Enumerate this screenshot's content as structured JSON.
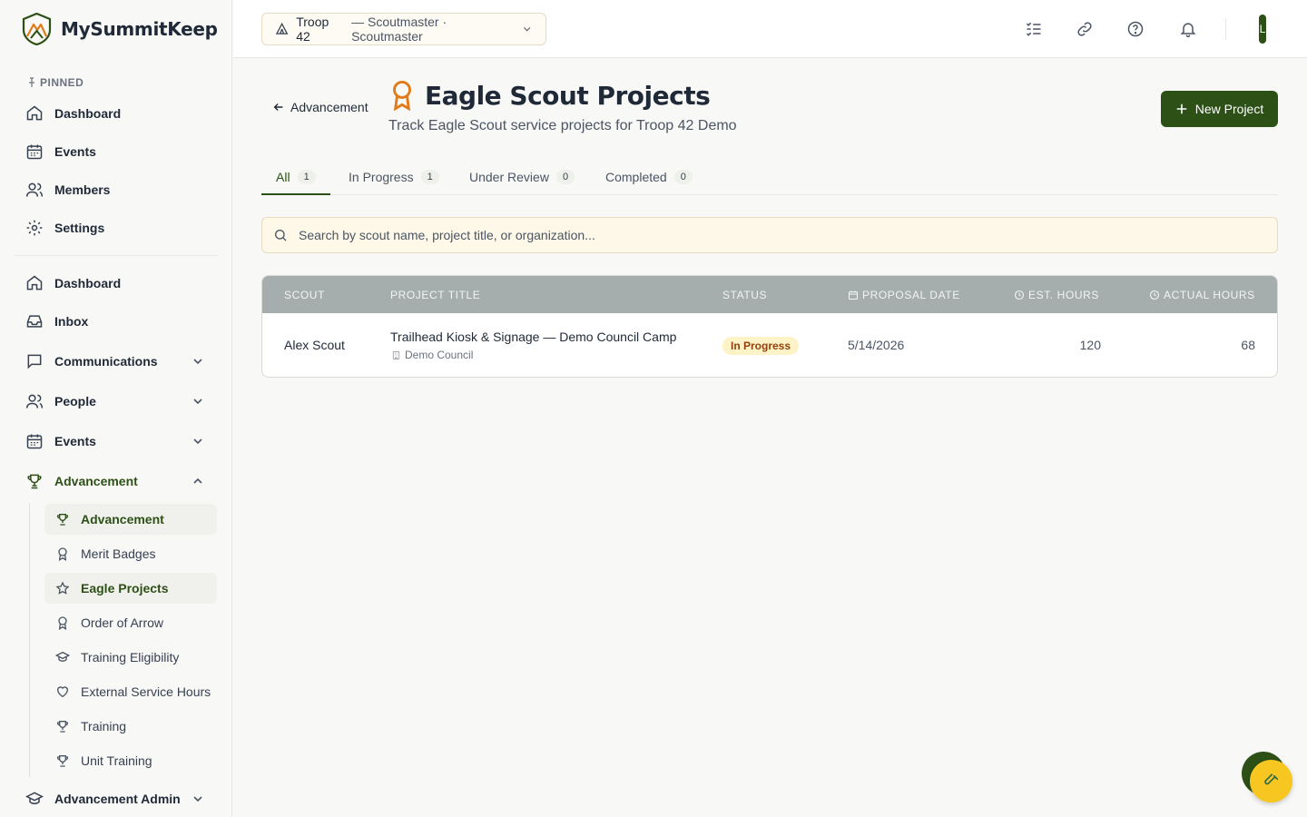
{
  "app": {
    "name": "MySummitKeep"
  },
  "sidebar": {
    "pinned_label": "PINNED",
    "pinned": [
      {
        "label": "Dashboard",
        "icon": "home-icon"
      },
      {
        "label": "Events",
        "icon": "calendar-icon"
      },
      {
        "label": "Members",
        "icon": "users-icon"
      },
      {
        "label": "Settings",
        "icon": "gear-icon"
      }
    ],
    "nav": [
      {
        "label": "Dashboard",
        "icon": "home-icon"
      },
      {
        "label": "Inbox",
        "icon": "inbox-icon"
      },
      {
        "label": "Communications",
        "icon": "message-icon",
        "expandable": true
      },
      {
        "label": "People",
        "icon": "users-icon",
        "expandable": true
      },
      {
        "label": "Events",
        "icon": "calendar-icon",
        "expandable": true
      },
      {
        "label": "Advancement",
        "icon": "trophy-icon",
        "expanded": true
      }
    ],
    "sub": [
      {
        "label": "Advancement",
        "icon": "trophy-icon"
      },
      {
        "label": "Merit Badges",
        "icon": "award-icon"
      },
      {
        "label": "Eagle Projects",
        "icon": "star-icon"
      },
      {
        "label": "Order of Arrow",
        "icon": "award-icon"
      },
      {
        "label": "Training Eligibility",
        "icon": "graduation-cap-icon"
      },
      {
        "label": "External Service Hours",
        "icon": "heart-icon"
      },
      {
        "label": "Training",
        "icon": "trophy-icon"
      },
      {
        "label": "Unit Training",
        "icon": "trophy-icon"
      }
    ],
    "admin": {
      "label": "Advancement Admin",
      "icon": "graduation-cap-icon"
    }
  },
  "topbar": {
    "troop": "Troop 42",
    "role": "— Scoutmaster · Scoutmaster",
    "avatar_letter": "L"
  },
  "page": {
    "back_label": "Advancement",
    "title": "Eagle Scout Projects",
    "subtitle": "Track Eagle Scout service projects for Troop 42 Demo",
    "new_button": "New Project"
  },
  "tabs": [
    {
      "label": "All",
      "count": "1"
    },
    {
      "label": "In Progress",
      "count": "1"
    },
    {
      "label": "Under Review",
      "count": "0"
    },
    {
      "label": "Completed",
      "count": "0"
    }
  ],
  "search": {
    "placeholder": "Search by scout name, project title, or organization..."
  },
  "table": {
    "headers": {
      "scout": "SCOUT",
      "project_title": "PROJECT TITLE",
      "status": "STATUS",
      "proposal_date": "PROPOSAL DATE",
      "est_hours": "EST. HOURS",
      "actual_hours": "ACTUAL HOURS"
    },
    "rows": [
      {
        "scout": "Alex Scout",
        "title": "Trailhead Kiosk & Signage — Demo Council Camp",
        "organization": "Demo Council",
        "status": "In Progress",
        "proposal_date": "5/14/2026",
        "est_hours": "120",
        "actual_hours": "68"
      }
    ]
  },
  "colors": {
    "brand": "#2d5016",
    "accent_orange": "#e07b1a",
    "badge_bg": "#fef3c7"
  }
}
